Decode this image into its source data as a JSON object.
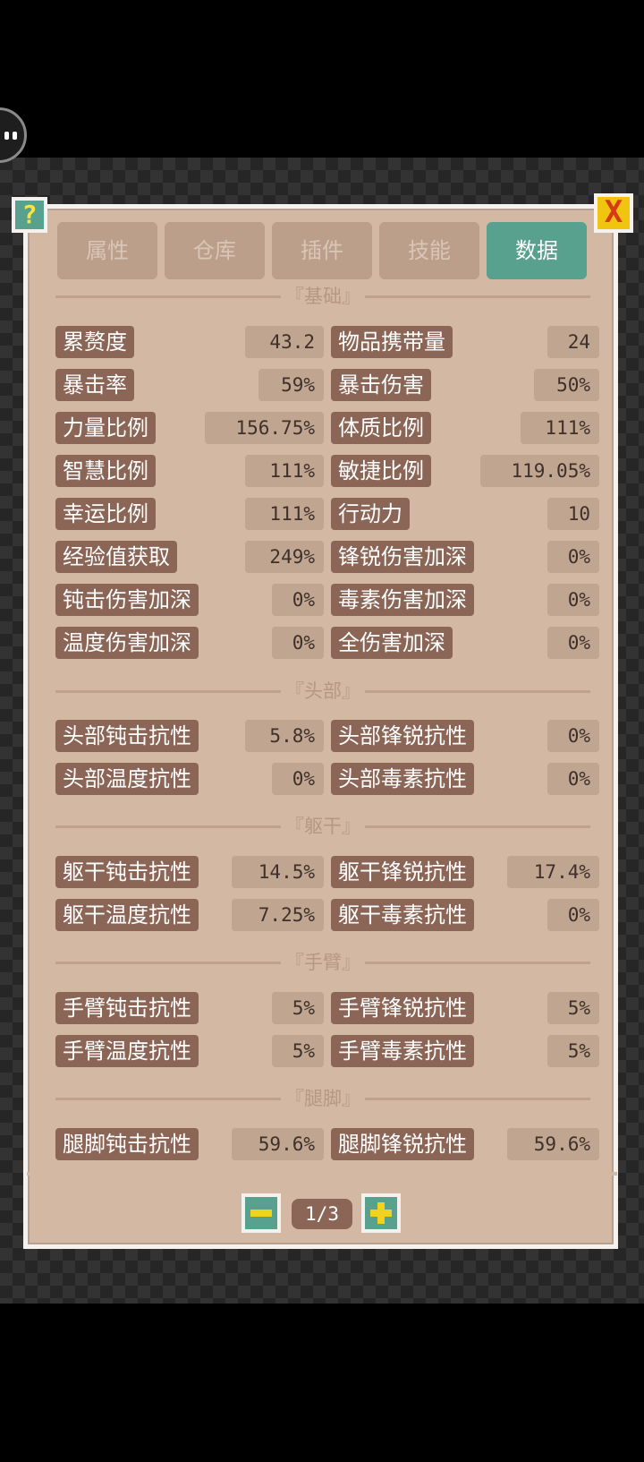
{
  "tabs": [
    "属性",
    "仓库",
    "插件",
    "技能",
    "数据"
  ],
  "active_tab": "数据",
  "sections": {
    "basic": "『基础』",
    "head": "『头部』",
    "torso": "『躯干』",
    "arms": "『手臂』",
    "legs": "『腿脚』"
  },
  "stats": {
    "basic": [
      {
        "l_label": "累赘度",
        "l_value": "43.2",
        "r_label": "物品携带量",
        "r_value": "24"
      },
      {
        "l_label": "暴击率",
        "l_value": "59%",
        "r_label": "暴击伤害",
        "r_value": "50%"
      },
      {
        "l_label": "力量比例",
        "l_value": "156.75%",
        "r_label": "体质比例",
        "r_value": "111%"
      },
      {
        "l_label": "智慧比例",
        "l_value": "111%",
        "r_label": "敏捷比例",
        "r_value": "119.05%"
      },
      {
        "l_label": "幸运比例",
        "l_value": "111%",
        "r_label": "行动力",
        "r_value": "10"
      },
      {
        "l_label": "经验值获取",
        "l_value": "249%",
        "r_label": "锋锐伤害加深",
        "r_value": "0%"
      },
      {
        "l_label": "钝击伤害加深",
        "l_value": "0%",
        "r_label": "毒素伤害加深",
        "r_value": "0%"
      },
      {
        "l_label": "温度伤害加深",
        "l_value": "0%",
        "r_label": "全伤害加深",
        "r_value": "0%"
      }
    ],
    "head": [
      {
        "l_label": "头部钝击抗性",
        "l_value": "5.8%",
        "r_label": "头部锋锐抗性",
        "r_value": "0%"
      },
      {
        "l_label": "头部温度抗性",
        "l_value": "0%",
        "r_label": "头部毒素抗性",
        "r_value": "0%"
      }
    ],
    "torso": [
      {
        "l_label": "躯干钝击抗性",
        "l_value": "14.5%",
        "r_label": "躯干锋锐抗性",
        "r_value": "17.4%"
      },
      {
        "l_label": "躯干温度抗性",
        "l_value": "7.25%",
        "r_label": "躯干毒素抗性",
        "r_value": "0%"
      }
    ],
    "arms": [
      {
        "l_label": "手臂钝击抗性",
        "l_value": "5%",
        "r_label": "手臂锋锐抗性",
        "r_value": "5%"
      },
      {
        "l_label": "手臂温度抗性",
        "l_value": "5%",
        "r_label": "手臂毒素抗性",
        "r_value": "5%"
      }
    ],
    "legs": [
      {
        "l_label": "腿脚钝击抗性",
        "l_value": "59.6%",
        "r_label": "腿脚锋锐抗性",
        "r_value": "59.6%"
      }
    ]
  },
  "buttons": {
    "help": "?",
    "close": "X"
  },
  "pager": {
    "label": "1/3",
    "page": 1,
    "total": 3
  },
  "colors": {
    "panel_bg": "#d3b8a3",
    "tab_active": "#58a18e",
    "tag_bg": "#8b6656",
    "value_bg": "#c0a590",
    "accent_yellow": "#f1c40f"
  },
  "icons": [
    "avatar-icon",
    "help-icon",
    "close-icon",
    "minus-icon",
    "plus-icon"
  ]
}
